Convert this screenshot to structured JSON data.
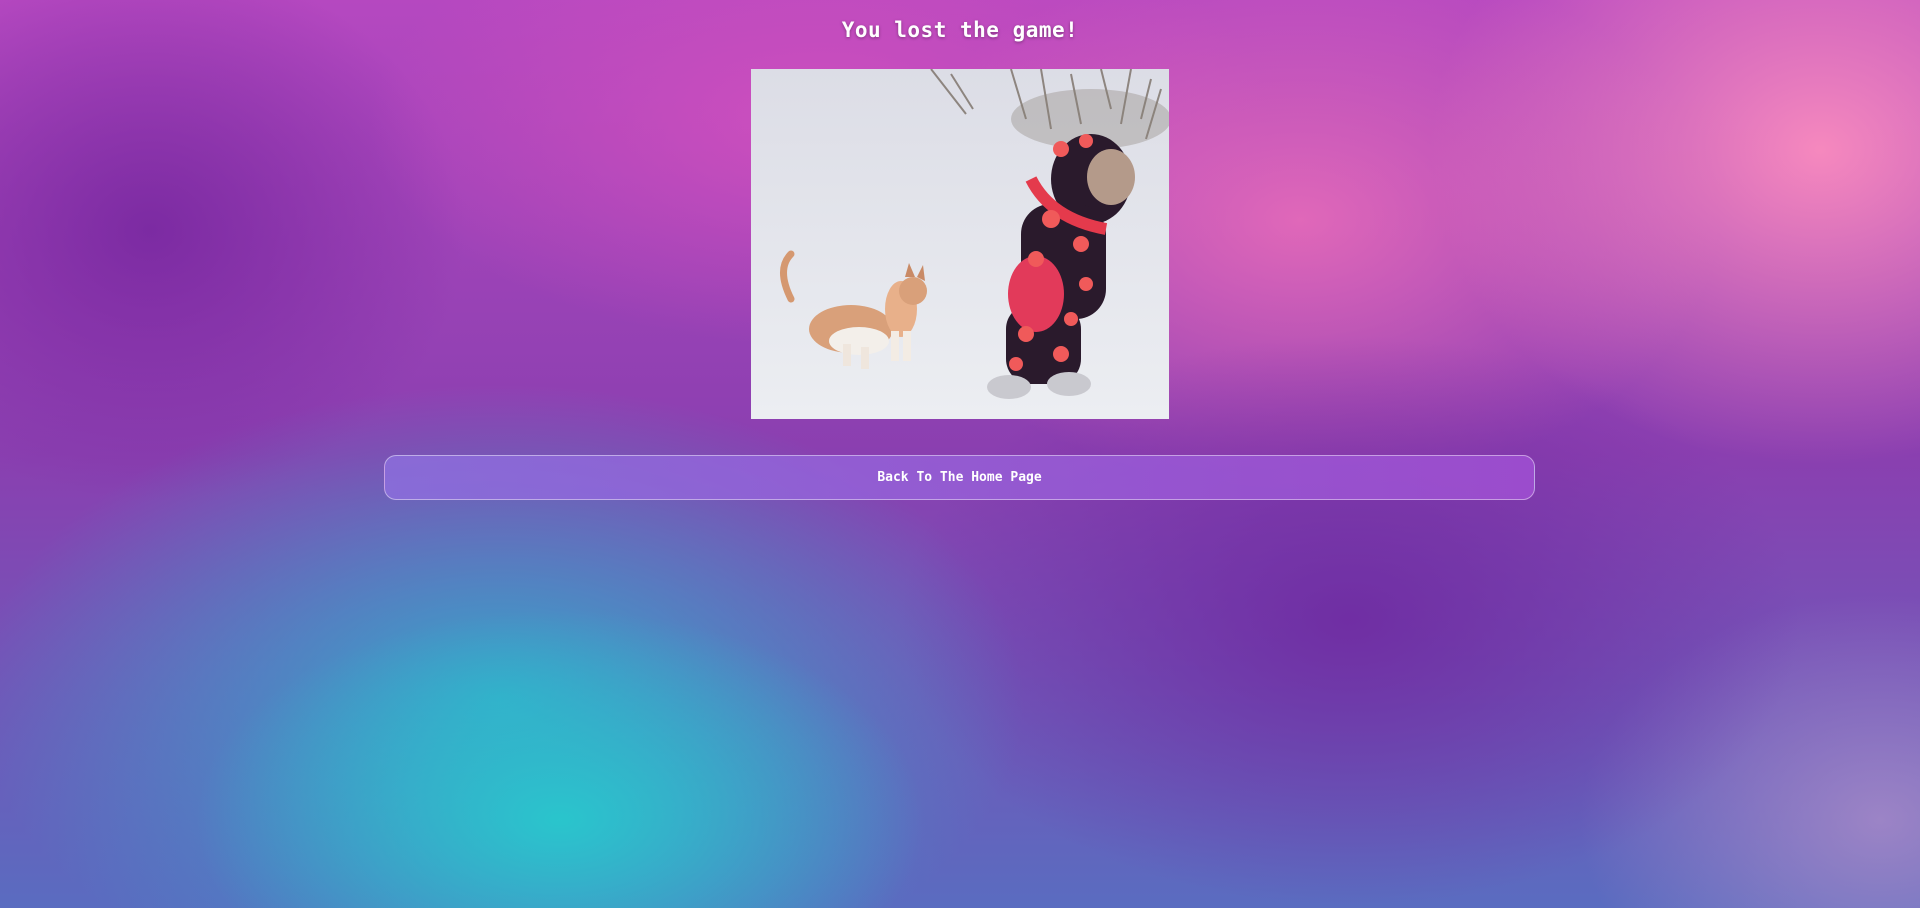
{
  "page": {
    "title": "You lost the game!"
  },
  "image": {
    "description_icon": "cat-and-child-in-snow-gif"
  },
  "actions": {
    "back_label": "Back To The Home Page"
  },
  "colors": {
    "button_bg": "#9b5fd6",
    "title": "#ffffff"
  }
}
